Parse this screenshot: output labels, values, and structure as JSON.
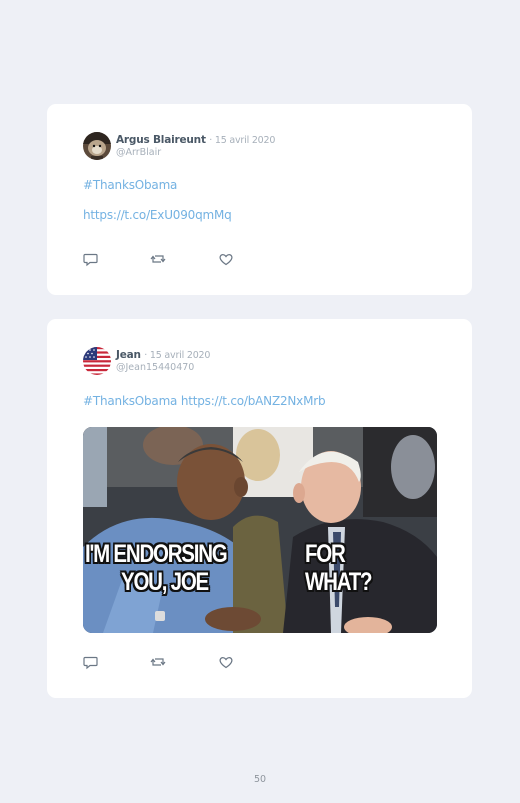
{
  "tweets": [
    {
      "author": "Argus Blaireunt",
      "date": "· 15 avril 2020",
      "handle": "@ArrBlair",
      "text": "#ThanksObama",
      "link": "https://t.co/ExU090qmMq"
    },
    {
      "author": "Jean",
      "date": "· 15 avril 2020",
      "handle": "@Jean15440470",
      "text": "#ThanksObama https://t.co/bANZ2NxMrb",
      "image": {
        "caption_left": [
          "I'M ENDORSING",
          "YOU, JOE"
        ],
        "caption_right": "FOR WHAT?"
      }
    }
  ],
  "page_number": "50",
  "colors": {
    "link": "#74b2e2",
    "card": "#ffffff",
    "background": "#eef0f6"
  },
  "icons": [
    "reply-icon",
    "retweet-icon",
    "like-icon"
  ]
}
